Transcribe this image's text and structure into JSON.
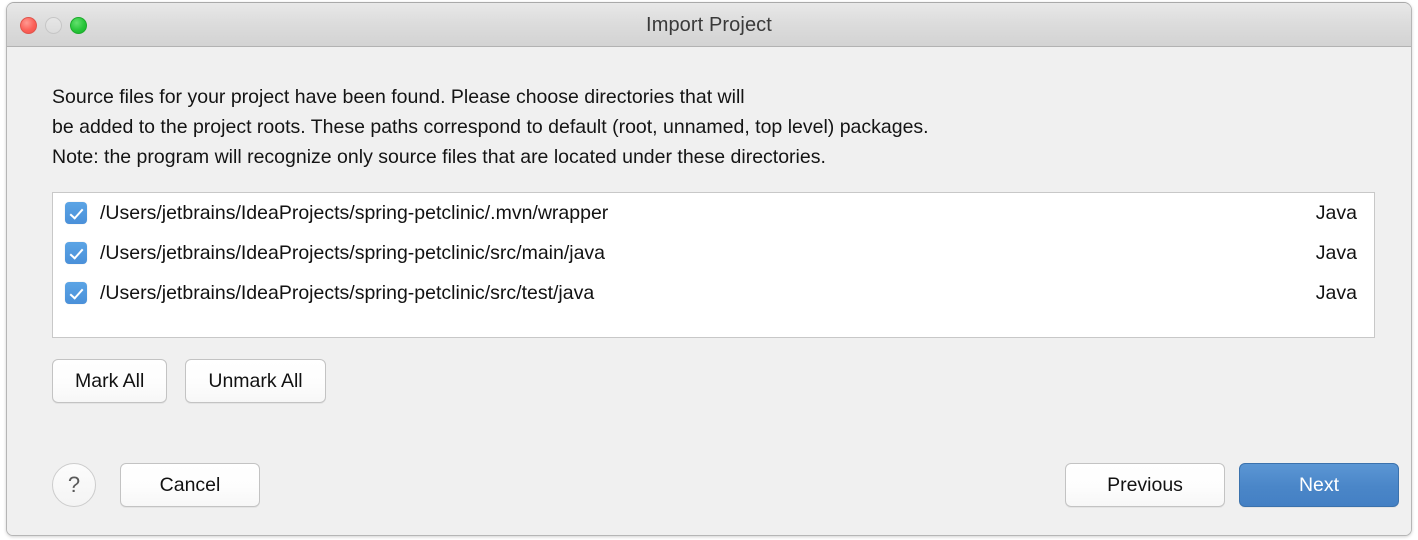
{
  "window": {
    "title": "Import Project",
    "traffic_lights": [
      {
        "name": "close",
        "color": "#fc6058"
      },
      {
        "name": "minimize",
        "color": "#e0e0e0"
      },
      {
        "name": "maximize",
        "color": "#28c63a"
      }
    ]
  },
  "description": "Source files for your project have been found. Please choose directories that will\nbe added to the project roots. These paths correspond to default (root, unnamed, top level) packages.\nNote: the program will recognize only source files that are located under these directories.",
  "list": {
    "rows": [
      {
        "checked": true,
        "path": "/Users/jetbrains/IdeaProjects/spring-petclinic/.mvn/wrapper",
        "type": "Java"
      },
      {
        "checked": true,
        "path": "/Users/jetbrains/IdeaProjects/spring-petclinic/src/main/java",
        "type": "Java"
      },
      {
        "checked": true,
        "path": "/Users/jetbrains/IdeaProjects/spring-petclinic/src/test/java",
        "type": "Java"
      }
    ]
  },
  "mark_buttons": {
    "mark_all": "Mark All",
    "unmark_all": "Unmark All"
  },
  "bottom_bar": {
    "help": "?",
    "cancel": "Cancel",
    "previous": "Previous",
    "next": "Next",
    "next_accent_color": "#4a86c8"
  }
}
